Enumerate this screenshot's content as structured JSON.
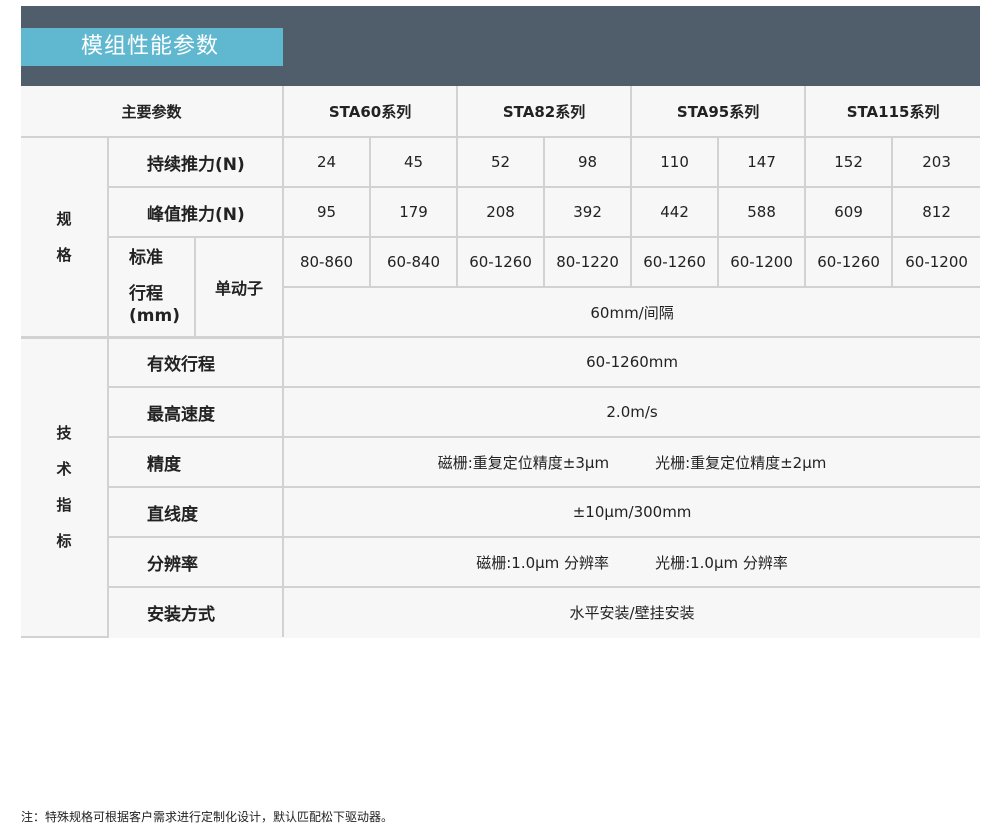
{
  "title": "模组性能参数",
  "header": {
    "main_params": "主要参数",
    "series": [
      "STA60系列",
      "STA82系列",
      "STA95系列",
      "STA115系列"
    ]
  },
  "spec": {
    "category": [
      "规",
      "格"
    ],
    "continuous_thrust": {
      "label": "持续推力(N)",
      "values": [
        "24",
        "45",
        "52",
        "98",
        "110",
        "147",
        "152",
        "203"
      ]
    },
    "peak_thrust": {
      "label": "峰值推力(N)",
      "values": [
        "95",
        "179",
        "208",
        "392",
        "442",
        "588",
        "609",
        "812"
      ]
    },
    "stroke": {
      "label_line1": "标准",
      "label_line2": "行程",
      "label_line3": "(mm)",
      "sub_label": "单动子",
      "values": [
        "80-860",
        "60-840",
        "60-1260",
        "80-1220",
        "60-1260",
        "60-1200",
        "60-1260",
        "60-1200"
      ],
      "interval": "60mm/间隔"
    }
  },
  "tech": {
    "category": [
      "技",
      "术",
      "指",
      "标"
    ],
    "rows": [
      {
        "label": "有效行程",
        "value": "60-1260mm"
      },
      {
        "label": "最高速度",
        "value": "2.0m/s"
      },
      {
        "label": "精度",
        "value_a": "磁栅:重复定位精度±3μm",
        "value_b": "光栅:重复定位精度±2μm"
      },
      {
        "label": "直线度",
        "value": "±10μm/300mm"
      },
      {
        "label": "分辨率",
        "value_a": "磁栅:1.0μm 分辨率",
        "value_b": "光栅:1.0μm 分辨率"
      },
      {
        "label": "安装方式",
        "value": "水平安装/壁挂安装"
      }
    ]
  },
  "footnote": "注：特殊规格可根据客户需求进行定制化设计，默认匹配松下驱动器。",
  "colors": {
    "header_bar": "#4f5e6a",
    "title_tab": "#5fb8cf",
    "table_bg": "#f7f7f7",
    "grid_line": "#d2d2d2"
  }
}
